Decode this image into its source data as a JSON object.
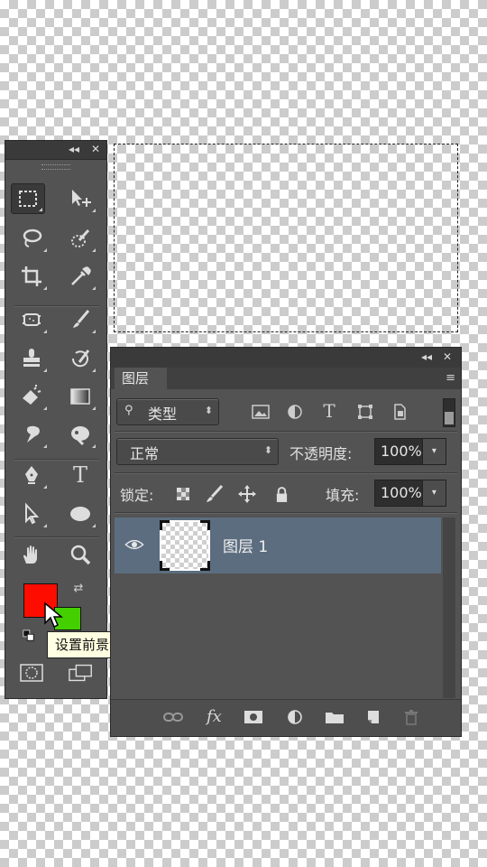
{
  "toolbox": {
    "header_collapse": "◂◂",
    "header_close": "✕",
    "type_tool_label": "T",
    "foreground_color": "#ff0c00",
    "background_color": "#44d000",
    "tooltip": "设置前景色",
    "tools": [
      "rectangular-marquee",
      "move",
      "lasso",
      "quick-selection",
      "crop",
      "eyedropper",
      "spot-healing-brush",
      "brush",
      "clone-stamp",
      "history-brush",
      "eraser",
      "gradient",
      "blur",
      "dodge",
      "pen",
      "type",
      "path-selection",
      "ellipse",
      "hand",
      "zoom"
    ]
  },
  "layers_panel": {
    "header_collapse": "◂◂",
    "header_close": "✕",
    "tab_label": "图层",
    "menu_icon": "≡",
    "filter_label": "类型",
    "filter_arrow": "⬍",
    "blend_mode": "正常",
    "blend_arrow": "⬍",
    "opacity_label": "不透明度:",
    "opacity_value": "100%",
    "lock_label": "锁定:",
    "fill_label": "填充:",
    "fill_value": "100%",
    "dropdown_button": "▾",
    "layers": [
      {
        "name": "图层 1",
        "visible": true,
        "selected": true
      }
    ],
    "footer_icons": [
      "link-icon",
      "fx-icon",
      "mask-icon",
      "adjustment-icon",
      "group-folder-icon",
      "new-layer-icon",
      "trash-icon"
    ],
    "fx_label": "fx"
  },
  "colors": {
    "panel_bg": "#535353",
    "selected_layer": "#5c6d80"
  }
}
